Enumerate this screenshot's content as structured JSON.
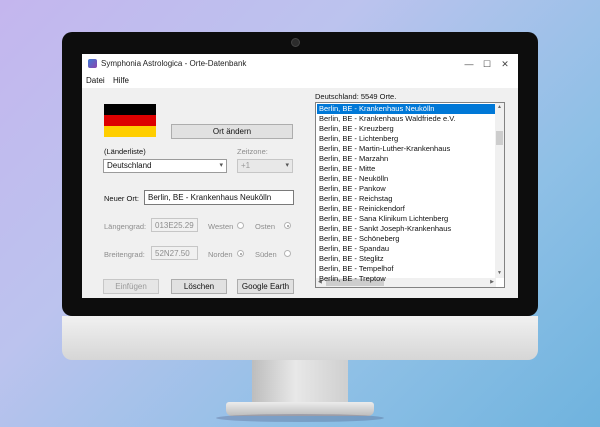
{
  "window": {
    "title": "Symphonia Astrologica - Orte-Datenbank",
    "minimize": "—",
    "maximize": "☐",
    "close": "✕"
  },
  "menu": {
    "items": [
      "Datei",
      "Hilfe"
    ]
  },
  "country": {
    "flag_colors": [
      "#000000",
      "#dd0000",
      "#ffce00"
    ],
    "change_button": "Ort ändern",
    "list_label": "(Länderliste)",
    "selected": "Deutschland",
    "timezone_label": "Zeitzone:",
    "timezone_value": "+1"
  },
  "place": {
    "new_label": "Neuer Ort:",
    "new_value": "Berlin, BE - Krankenhaus Neukölln"
  },
  "longitude": {
    "label": "Längengrad:",
    "value": "013E25.29",
    "west": "Westen",
    "east": "Osten"
  },
  "latitude": {
    "label": "Breitengrad:",
    "value": "52N27.50",
    "north": "Norden",
    "south": "Süden"
  },
  "buttons": {
    "insert": "Einfügen",
    "delete": "Löschen",
    "google_earth": "Google Earth"
  },
  "places_list": {
    "header": "Deutschland: 5549 Orte.",
    "items": [
      "Berlin, BE - Krankenhaus Neukölln",
      "Berlin, BE - Krankenhaus Waldfriede e.V.",
      "Berlin, BE - Kreuzberg",
      "Berlin, BE - Lichtenberg",
      "Berlin, BE - Martin-Luther-Krankenhaus",
      "Berlin, BE - Marzahn",
      "Berlin, BE - Mitte",
      "Berlin, BE - Neukölln",
      "Berlin, BE - Pankow",
      "Berlin, BE - Reichstag",
      "Berlin, BE - Reinickendorf",
      "Berlin, BE - Sana Klinikum Lichtenberg",
      "Berlin, BE - Sankt Joseph-Krankenhaus",
      "Berlin, BE - Schöneberg",
      "Berlin, BE - Spandau",
      "Berlin, BE - Steglitz",
      "Berlin, BE - Tempelhof",
      "Berlin, BE - Treptow"
    ],
    "selected_index": 0
  }
}
